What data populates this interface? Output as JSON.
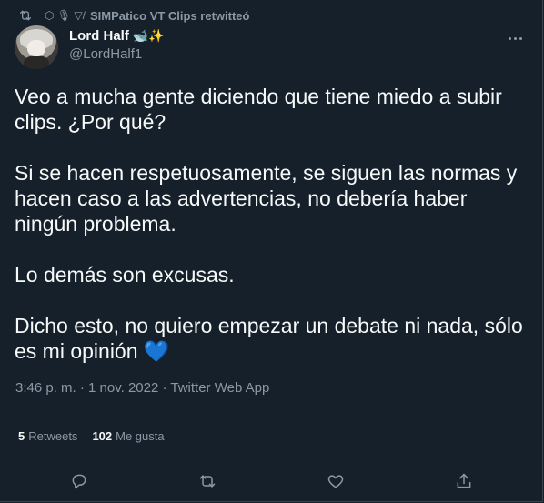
{
  "retweet_bar": {
    "prefix": "⬡ 🎙 ▽/",
    "text": "SIMPatico VT Clips retwitteó"
  },
  "author": {
    "display_name": "Lord Half",
    "name_emoji": "🐋✨",
    "handle": "@LordHalf1"
  },
  "tweet": {
    "text": "Veo a mucha gente diciendo que tiene miedo a subir\nclips. ¿Por qué?\n\nSi se hacen respetuosamente, se siguen las normas y\nhacen caso a las advertencias, no debería haber\nningún problema.\n\nLo demás son excusas.\n\nDicho esto, no quiero empezar un debate ni nada, sólo\nes mi opinión",
    "trailing_emoji": "💙",
    "meta": "3:46 p. m. · 1 nov. 2022 · Twitter Web App"
  },
  "stats": {
    "retweets_count": "5",
    "retweets_label": "Retweets",
    "likes_count": "102",
    "likes_label": "Me gusta"
  },
  "actions": {
    "reply_icon": "reply-icon",
    "retweet_icon": "retweet-icon",
    "like_icon": "heart-icon",
    "share_icon": "share-icon"
  },
  "colors": {
    "background": "#15202b",
    "text": "#f7f9f9",
    "secondary": "#8b98a5",
    "divider": "#38444d",
    "heart_emoji": "#5fa8e8"
  }
}
